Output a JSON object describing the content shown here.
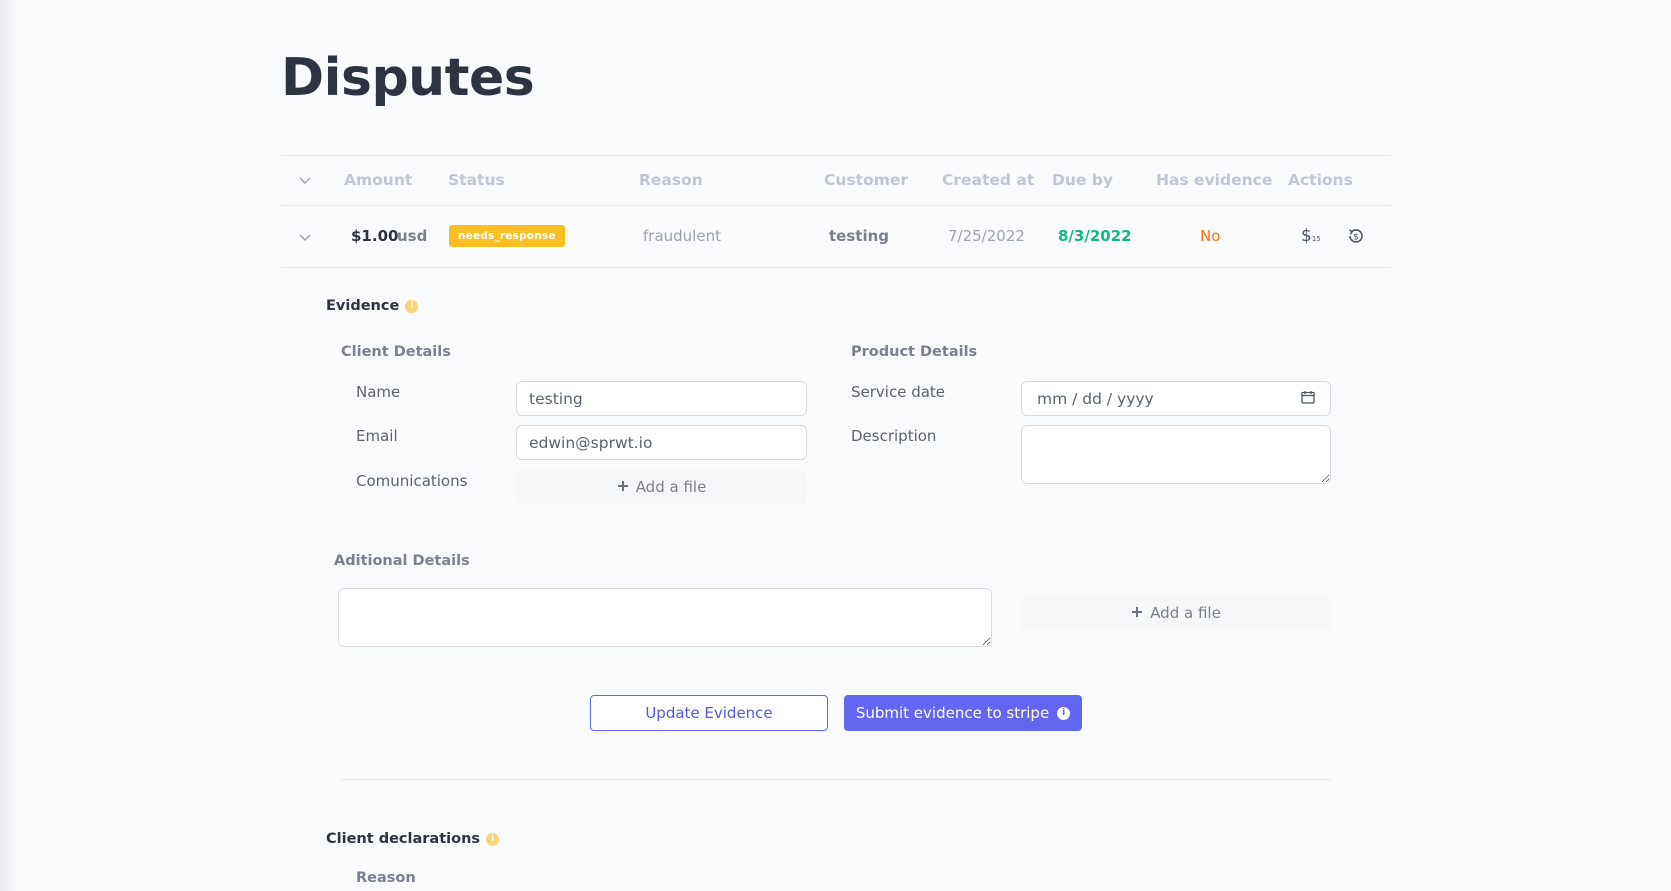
{
  "page": {
    "title": "Disputes"
  },
  "table": {
    "headers": {
      "amount": "Amount",
      "status": "Status",
      "reason": "Reason",
      "customer": "Customer",
      "created_at": "Created at",
      "due_by": "Due by",
      "has_evidence": "Has evidence",
      "actions": "Actions"
    },
    "row": {
      "amount": "$1.00",
      "currency": "usd",
      "status": "needs_response",
      "reason": "fraudulent",
      "customer": "testing",
      "created_at": "7/25/2022",
      "due_by": "8/3/2022",
      "has_evidence": "No",
      "action_money_icon_text": "$",
      "action_money_icon_sub": "15"
    }
  },
  "evidence": {
    "title": "Evidence",
    "info_glyph": "i",
    "client_details": {
      "title": "Client Details",
      "name_label": "Name",
      "name_value": "testing",
      "email_label": "Email",
      "email_value": "edwin@sprwt.io",
      "communications_label": "Comunications",
      "add_file": "Add a file"
    },
    "product_details": {
      "title": "Product Details",
      "service_date_label": "Service date",
      "service_date_placeholder": "mm / dd / yyyy",
      "description_label": "Description",
      "description_value": ""
    },
    "additional_details": {
      "title": "Aditional Details",
      "value": "",
      "add_file": "Add a file"
    },
    "update_button": "Update Evidence",
    "submit_button": "Submit evidence to stripe"
  },
  "client_declarations": {
    "title": "Client declarations",
    "reason_label": "Reason"
  },
  "colors": {
    "badge": "#fbbf24",
    "due_by": "#10b981",
    "has_evidence_no": "#f97316",
    "primary": "#6366f1",
    "info": "#f7d478"
  },
  "icons": {
    "collapse_all": "chevron-down-icon",
    "row_toggle": "chevron-down-icon",
    "action_money": "dollar-icon",
    "action_refund": "refund-history-icon",
    "add": "plus-icon",
    "calendar": "calendar-icon",
    "info": "info-icon"
  }
}
